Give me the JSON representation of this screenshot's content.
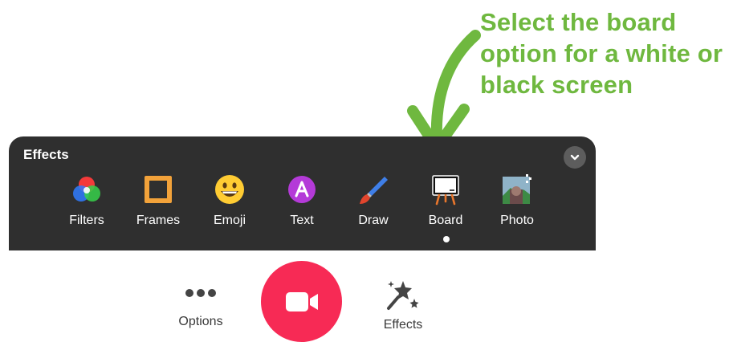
{
  "callout": {
    "text": "Select the board\noption for a white or\nblack screen",
    "color": "#6fb83f"
  },
  "effects_panel": {
    "title": "Effects",
    "collapse_icon": "chevron-down-icon",
    "tools": [
      {
        "label": "Filters",
        "icon": "filters-icon"
      },
      {
        "label": "Frames",
        "icon": "frame-icon"
      },
      {
        "label": "Emoji",
        "icon": "emoji-icon"
      },
      {
        "label": "Text",
        "icon": "text-icon"
      },
      {
        "label": "Draw",
        "icon": "brush-icon"
      },
      {
        "label": "Board",
        "icon": "board-icon",
        "selected": true
      },
      {
        "label": "Photo",
        "icon": "photo-icon"
      }
    ]
  },
  "bottom_bar": {
    "options_label": "Options",
    "effects_label": "Effects",
    "record_icon": "video-camera-icon",
    "record_color": "#f72a55"
  }
}
